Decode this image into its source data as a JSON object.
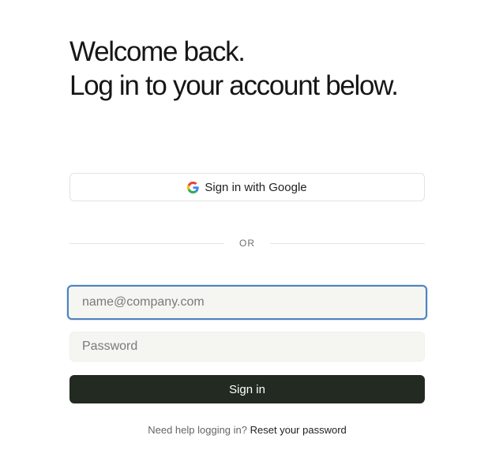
{
  "heading": {
    "line1": "Welcome back.",
    "line2": "Log in to your account below."
  },
  "google_button": {
    "label": "Sign in with Google",
    "icon": "google-icon"
  },
  "divider": {
    "text": "OR"
  },
  "form": {
    "email": {
      "value": "",
      "placeholder": "name@company.com"
    },
    "password": {
      "value": "",
      "placeholder": "Password"
    },
    "submit_label": "Sign in"
  },
  "help": {
    "text": "Need help logging in?",
    "link_label": "Reset your password"
  },
  "colors": {
    "button_bg": "#222a22",
    "focus_border": "#4f82bd",
    "input_bg": "#f5f5f2"
  }
}
